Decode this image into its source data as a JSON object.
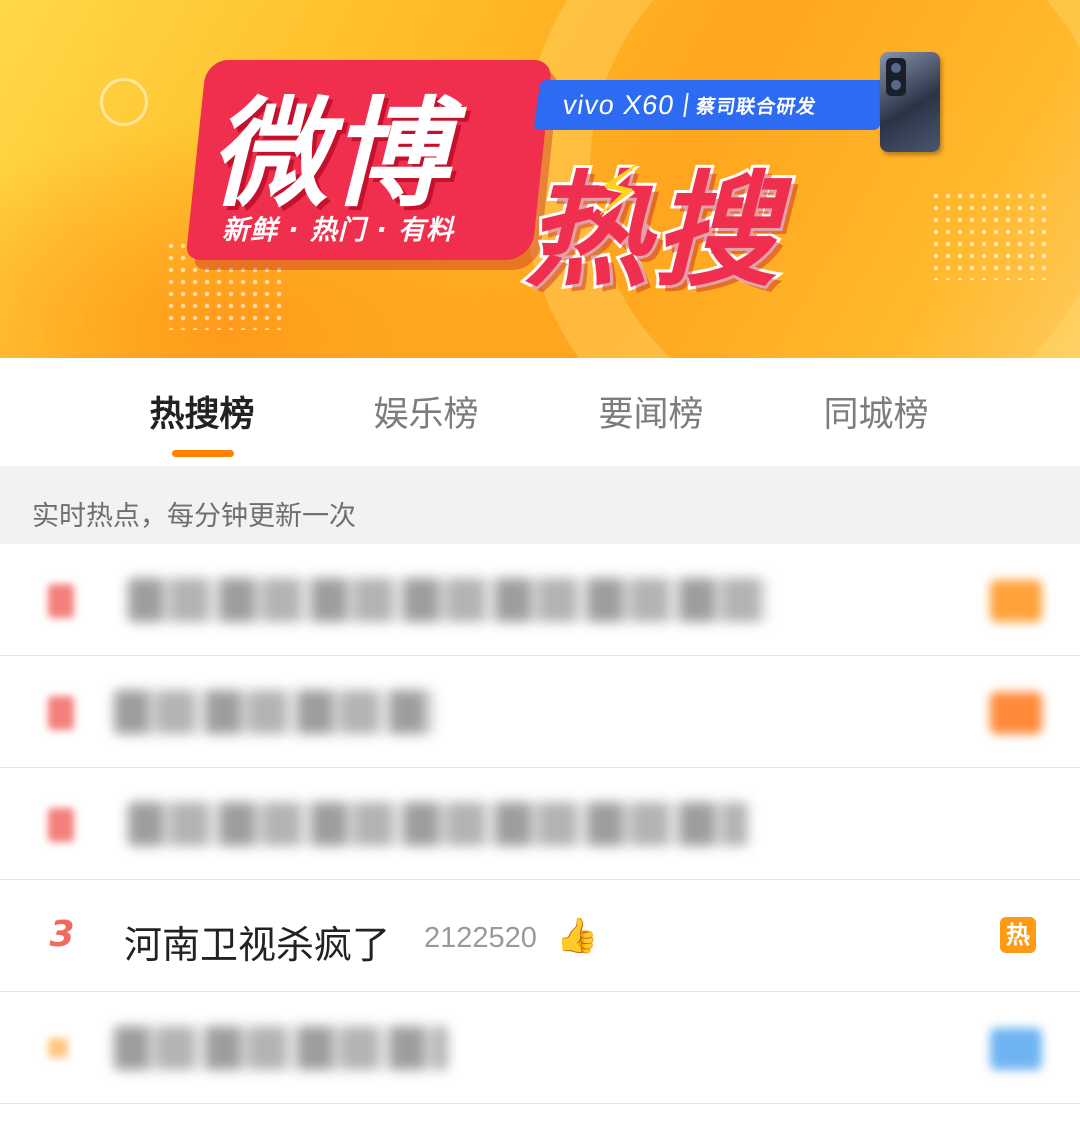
{
  "banner": {
    "logo_main": "微博",
    "logo_hot": "热搜",
    "tagline": "新鲜 · 热门 · 有料",
    "sponsor_brand": "vivo X60",
    "sponsor_text": "蔡司联合研发",
    "lightning_icon": "lightning-icon",
    "phone_image": "phone-product-image"
  },
  "tabs": [
    {
      "label": "热搜榜",
      "active": true
    },
    {
      "label": "娱乐榜",
      "active": false
    },
    {
      "label": "要闻榜",
      "active": false
    },
    {
      "label": "同城榜",
      "active": false
    }
  ],
  "subheader": "实时热点，每分钟更新一次",
  "colors": {
    "accent": "#ff8200",
    "rank": "#f26a5e",
    "hot_badge": "#ff9a14",
    "logo_red": "#ef2f4d",
    "sponsor_blue": "#2d6bf2"
  },
  "list": [
    {
      "blurred": true,
      "badge_color": "#ffa23a"
    },
    {
      "blurred": true,
      "badge_color": "#ff8a3a"
    },
    {
      "blurred": true,
      "badge_color": null
    },
    {
      "rank": "3",
      "title": "河南卫视杀疯了",
      "count": "2122520",
      "icon": "thumbs-up-icon",
      "badge": "热"
    },
    {
      "blurred": true,
      "badge_color": "#6fb4f2"
    }
  ]
}
